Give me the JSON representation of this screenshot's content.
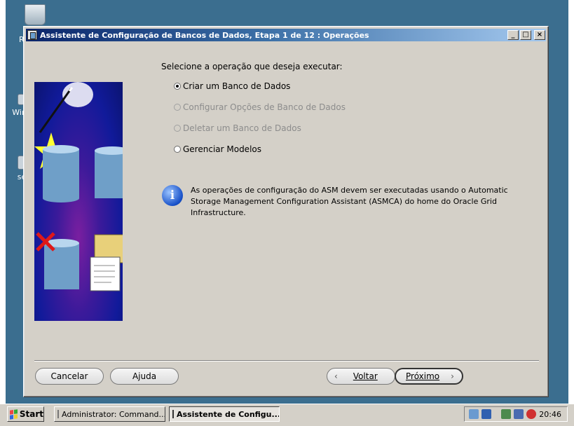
{
  "window": {
    "title": "Assistente de Configuração de Bancos de Dados, Etapa 1 de 12 : Operações",
    "controls": {
      "minimize": "_",
      "maximize": "□",
      "close": "×"
    }
  },
  "main": {
    "prompt": "Selecione a operação que deseja executar:",
    "options": [
      {
        "label": "Criar um Banco de Dados",
        "selected": true,
        "enabled": true
      },
      {
        "label": "Configurar Opções de Banco de Dados",
        "selected": false,
        "enabled": false
      },
      {
        "label": "Deletar um Banco de Dados",
        "selected": false,
        "enabled": false
      },
      {
        "label": "Gerenciar Modelos",
        "selected": false,
        "enabled": true
      }
    ],
    "info_icon": "i",
    "info": "As operações de configuração do ASM devem ser executadas usando o Automatic Storage Management Configuration Assistant (ASMCA) do home do Oracle Grid Infrastructure."
  },
  "buttons": {
    "cancel": "Cancelar",
    "help": "Ajuda",
    "back": "Voltar",
    "next": "Próximo",
    "back_arrow": "‹",
    "next_arrow": "›"
  },
  "taskbar": {
    "start": "Start",
    "items": [
      {
        "label": "Administrator: Command...",
        "active": false
      },
      {
        "label": "Assistente de Configu...",
        "active": true
      }
    ],
    "clock": "20:46"
  },
  "desktop": {
    "icons": [
      "Re",
      "WinT",
      "se"
    ]
  },
  "colors": {
    "titlebar_start": "#0a246a",
    "titlebar_end": "#a6caf0",
    "window_face": "#d4d0c8",
    "desktop": "#3b6e8f"
  }
}
